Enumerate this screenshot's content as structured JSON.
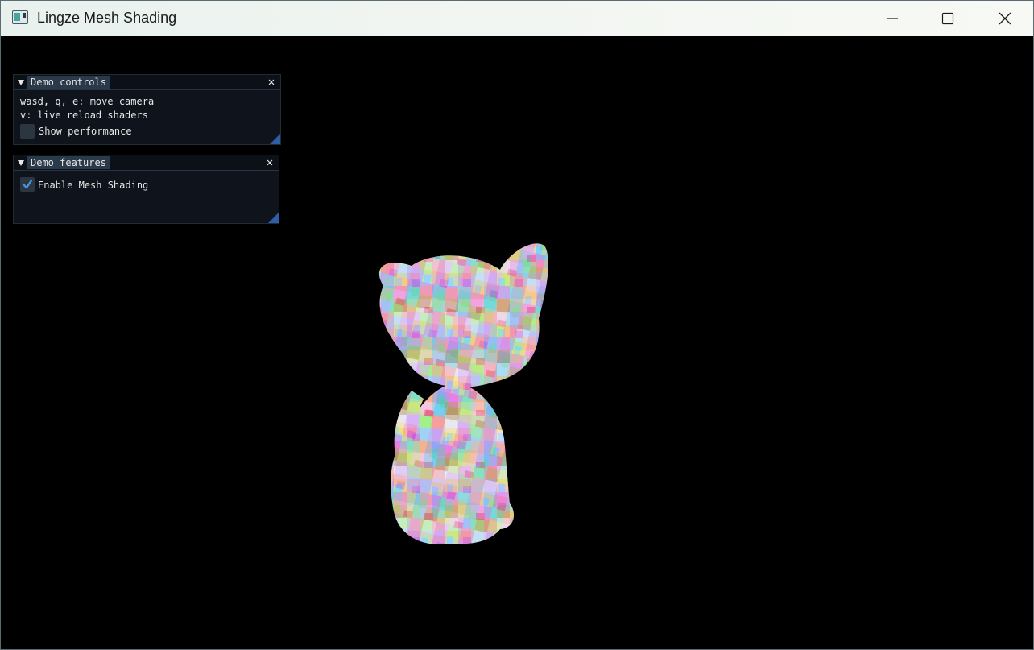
{
  "window": {
    "title": "Lingze Mesh Shading",
    "icon": "app-window-icon"
  },
  "demo_controls": {
    "tab_label": "Demo controls",
    "line1": "wasd, q, e: move camera",
    "line2": "v: live reload shaders",
    "show_performance_label": "Show performance",
    "show_performance_checked": false
  },
  "demo_features": {
    "tab_label": "Demo features",
    "enable_mesh_shading_label": "Enable Mesh Shading",
    "enable_mesh_shading_checked": true
  },
  "colors": {
    "panel_bg": "#10161e",
    "tab_bg": "#2b3a4a",
    "checkbox_bg": "#2b3640",
    "check_mark": "#4a90e2",
    "resize_grip": "#2e5fa6"
  }
}
